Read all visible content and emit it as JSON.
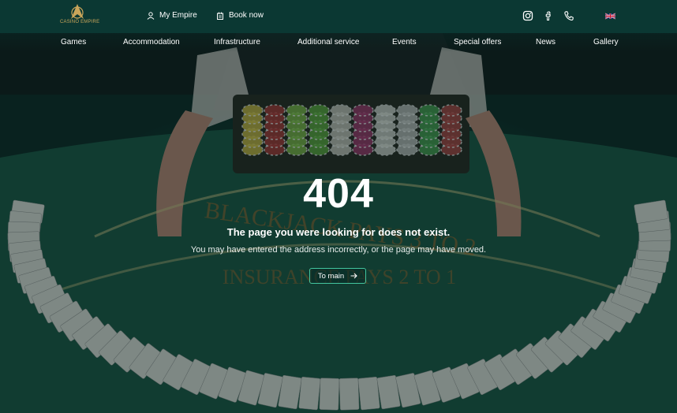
{
  "header": {
    "logo_text": "CASINO EMPIRE",
    "my_empire": "My Empire",
    "book_now": "Book now",
    "social_icons": [
      "instagram-icon",
      "facebook-icon",
      "phone-icon"
    ],
    "language_icon": "uk-flag-icon"
  },
  "nav": {
    "items": [
      {
        "label": "Games"
      },
      {
        "label": "Accommodation"
      },
      {
        "label": "Infrastructure"
      },
      {
        "label": "Additional service"
      },
      {
        "label": "Events"
      },
      {
        "label": "Special offers"
      },
      {
        "label": "News"
      },
      {
        "label": "Gallery"
      }
    ]
  },
  "error": {
    "code": "404",
    "title": "The page you were looking for does not exist.",
    "subtitle": "You may have entered the address incorrectly, or the page may have moved.",
    "button_label": "To main"
  },
  "colors": {
    "header_bg": "#0b3833",
    "accent": "#43c59e",
    "logo_gold": "#c9a55a"
  }
}
